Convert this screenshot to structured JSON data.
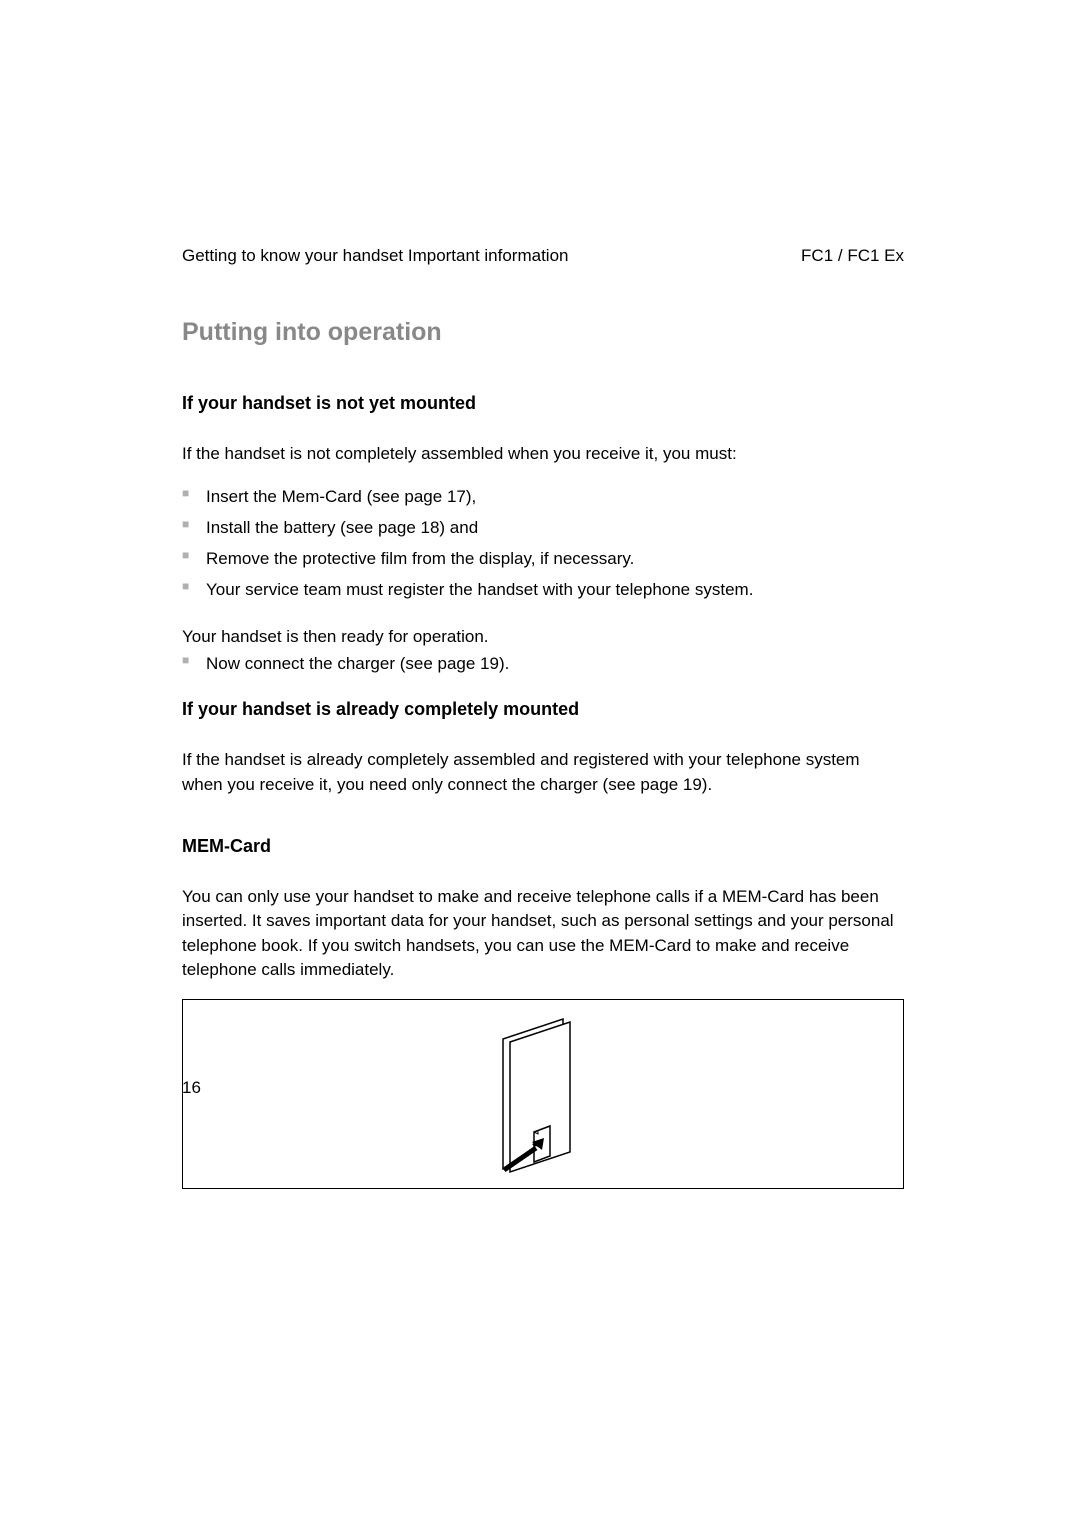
{
  "header": {
    "left": "Getting to know your handset Important information",
    "right": "FC1 / FC1 Ex"
  },
  "main_heading": "Putting into operation",
  "sections": {
    "notMounted": {
      "heading": "If your handset is not yet mounted",
      "intro": "If the handset is not completely assembled when you receive it, you must:",
      "bullets": [
        "Insert the Mem-Card (see page 17),",
        "Install the battery (see page 18) and",
        "Remove the protective film from the display, if necessary.",
        "Your service team must register the handset with your telephone system."
      ],
      "ready_text": "Your handset is then ready for operation.",
      "ready_bullets": [
        "Now connect the charger (see page 19)."
      ]
    },
    "alreadyMounted": {
      "heading": "If your handset is already completely mounted",
      "body": "If the handset is already completely assembled and registered with your telephone system when you receive it, you need only connect the charger (see page 19)."
    },
    "memCard": {
      "heading": "MEM-Card",
      "body": "You can only use your handset to make and receive telephone calls if a MEM-Card has been inserted. It saves important data for your handset, such as personal settings and your personal telephone book. If you switch handsets, you can use the MEM-Card to make and receive telephone calls immediately."
    }
  },
  "page_number": "16"
}
